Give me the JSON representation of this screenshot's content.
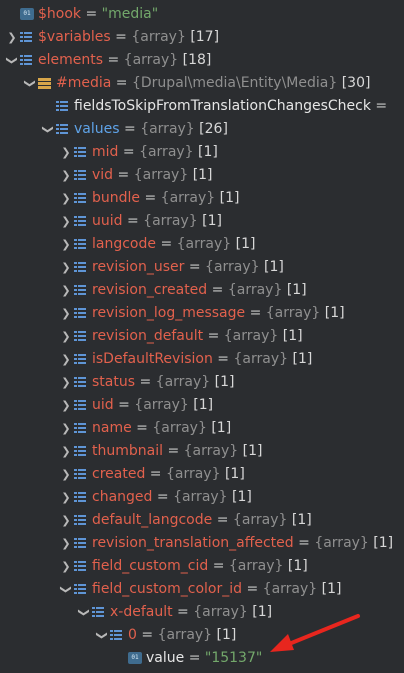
{
  "colors": {
    "background": "#2b2d30",
    "var_name": "#e2614d",
    "string_value": "#73a86b",
    "type_text": "#8f8f8f",
    "selected_name": "#5fa3e8",
    "arrow": "#e8261e"
  },
  "rows": [
    {
      "level": 0,
      "arrow": "none",
      "icon": "tag-icon",
      "icon_text": "01",
      "name": "$hook",
      "name_style": "red",
      "type": "",
      "count": "",
      "string": "\"media\""
    },
    {
      "level": 0,
      "arrow": "right",
      "icon": "list-icon",
      "name": "$variables",
      "name_style": "red",
      "type": "{array}",
      "count": "[17]"
    },
    {
      "level": 0,
      "arrow": "down",
      "icon": "list-icon",
      "name": "elements",
      "name_style": "red",
      "type": "{array}",
      "count": "[18]"
    },
    {
      "level": 1,
      "arrow": "down",
      "icon": "obj-icon",
      "name": "#media",
      "name_style": "red",
      "type": "{Drupal\\media\\Entity\\Media}",
      "count": "[30]"
    },
    {
      "level": 2,
      "arrow": "none",
      "icon": "list-icon",
      "name": "fieldsToSkipFromTranslationChangesCheck",
      "name_style": "white",
      "type": "",
      "count": "",
      "trail": "="
    },
    {
      "level": 2,
      "arrow": "down",
      "icon": "list-icon",
      "name": "values",
      "name_style": "blue",
      "type": "{array}",
      "count": "[26]"
    },
    {
      "level": 3,
      "arrow": "right",
      "icon": "list-icon",
      "name": "mid",
      "name_style": "red",
      "type": "{array}",
      "count": "[1]"
    },
    {
      "level": 3,
      "arrow": "right",
      "icon": "list-icon",
      "name": "vid",
      "name_style": "red",
      "type": "{array}",
      "count": "[1]"
    },
    {
      "level": 3,
      "arrow": "right",
      "icon": "list-icon",
      "name": "bundle",
      "name_style": "red",
      "type": "{array}",
      "count": "[1]"
    },
    {
      "level": 3,
      "arrow": "right",
      "icon": "list-icon",
      "name": "uuid",
      "name_style": "red",
      "type": "{array}",
      "count": "[1]"
    },
    {
      "level": 3,
      "arrow": "right",
      "icon": "list-icon",
      "name": "langcode",
      "name_style": "red",
      "type": "{array}",
      "count": "[1]"
    },
    {
      "level": 3,
      "arrow": "right",
      "icon": "list-icon",
      "name": "revision_user",
      "name_style": "red",
      "type": "{array}",
      "count": "[1]"
    },
    {
      "level": 3,
      "arrow": "right",
      "icon": "list-icon",
      "name": "revision_created",
      "name_style": "red",
      "type": "{array}",
      "count": "[1]"
    },
    {
      "level": 3,
      "arrow": "right",
      "icon": "list-icon",
      "name": "revision_log_message",
      "name_style": "red",
      "type": "{array}",
      "count": "[1]"
    },
    {
      "level": 3,
      "arrow": "right",
      "icon": "list-icon",
      "name": "revision_default",
      "name_style": "red",
      "type": "{array}",
      "count": "[1]"
    },
    {
      "level": 3,
      "arrow": "right",
      "icon": "list-icon",
      "name": "isDefaultRevision",
      "name_style": "red",
      "type": "{array}",
      "count": "[1]"
    },
    {
      "level": 3,
      "arrow": "right",
      "icon": "list-icon",
      "name": "status",
      "name_style": "red",
      "type": "{array}",
      "count": "[1]"
    },
    {
      "level": 3,
      "arrow": "right",
      "icon": "list-icon",
      "name": "uid",
      "name_style": "red",
      "type": "{array}",
      "count": "[1]"
    },
    {
      "level": 3,
      "arrow": "right",
      "icon": "list-icon",
      "name": "name",
      "name_style": "red",
      "type": "{array}",
      "count": "[1]"
    },
    {
      "level": 3,
      "arrow": "right",
      "icon": "list-icon",
      "name": "thumbnail",
      "name_style": "red",
      "type": "{array}",
      "count": "[1]"
    },
    {
      "level": 3,
      "arrow": "right",
      "icon": "list-icon",
      "name": "created",
      "name_style": "red",
      "type": "{array}",
      "count": "[1]"
    },
    {
      "level": 3,
      "arrow": "right",
      "icon": "list-icon",
      "name": "changed",
      "name_style": "red",
      "type": "{array}",
      "count": "[1]"
    },
    {
      "level": 3,
      "arrow": "right",
      "icon": "list-icon",
      "name": "default_langcode",
      "name_style": "red",
      "type": "{array}",
      "count": "[1]"
    },
    {
      "level": 3,
      "arrow": "right",
      "icon": "list-icon",
      "name": "revision_translation_affected",
      "name_style": "red",
      "type": "{array}",
      "count": "[1]"
    },
    {
      "level": 3,
      "arrow": "right",
      "icon": "list-icon",
      "name": "field_custom_cid",
      "name_style": "red",
      "type": "{array}",
      "count": "[1]"
    },
    {
      "level": 3,
      "arrow": "down",
      "icon": "list-icon",
      "name": "field_custom_color_id",
      "name_style": "red",
      "type": "{array}",
      "count": "[1]"
    },
    {
      "level": 4,
      "arrow": "down",
      "icon": "list-icon",
      "name": "x-default",
      "name_style": "red",
      "type": "{array}",
      "count": "[1]"
    },
    {
      "level": 5,
      "arrow": "down",
      "icon": "list-icon",
      "name": "0",
      "name_style": "red",
      "type": "{array}",
      "count": "[1]"
    },
    {
      "level": 6,
      "arrow": "none",
      "icon": "tag-icon",
      "icon_text": "01",
      "name": "value",
      "name_style": "white",
      "type": "",
      "count": "",
      "string": "\"15137\""
    }
  ]
}
